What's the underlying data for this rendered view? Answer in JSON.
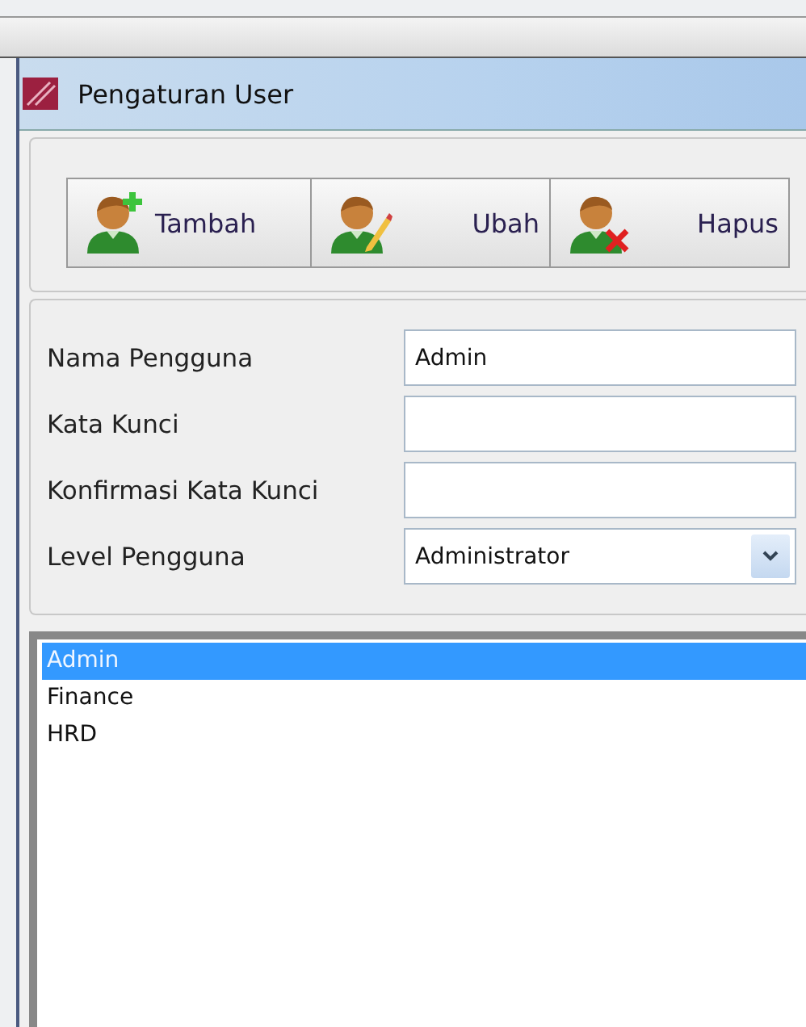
{
  "window": {
    "title": "Pengaturan User"
  },
  "toolbar": [
    {
      "kind": "add",
      "label": "Tambah"
    },
    {
      "kind": "edit",
      "label": "Ubah"
    },
    {
      "kind": "delete",
      "label": "Hapus"
    }
  ],
  "form": [
    {
      "kind": "text",
      "label": "Nama Pengguna",
      "value": "Admin"
    },
    {
      "kind": "password",
      "label": "Kata Kunci"
    },
    {
      "kind": "password",
      "label": "Konfirmasi Kata Kunci"
    },
    {
      "kind": "select",
      "label": "Level Pengguna",
      "value": "Administrator"
    }
  ],
  "user_list": [
    {
      "name": "Admin",
      "selected": true
    },
    {
      "name": "Finance",
      "selected": false
    },
    {
      "name": "HRD",
      "selected": false
    }
  ]
}
